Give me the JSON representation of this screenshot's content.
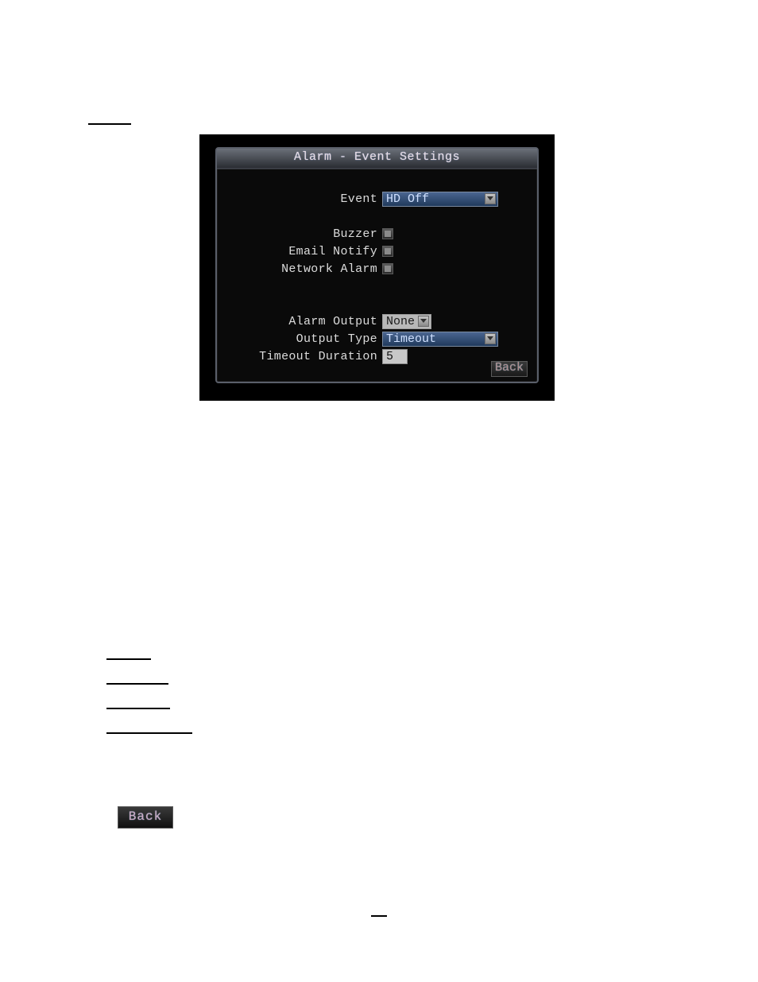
{
  "dialog": {
    "title": "Alarm - Event Settings",
    "event": {
      "label": "Event",
      "value": "HD Off"
    },
    "buzzer": {
      "label": "Buzzer",
      "checked": false
    },
    "email": {
      "label": "Email Notify",
      "checked": false
    },
    "network": {
      "label": "Network Alarm",
      "checked": false
    },
    "alarm_output": {
      "label": "Alarm Output",
      "value": "None"
    },
    "output_type": {
      "label": "Output Type",
      "value": "Timeout"
    },
    "timeout_duration": {
      "label": "Timeout Duration",
      "value": "5"
    },
    "back": "Back"
  },
  "bottom_back": "Back"
}
